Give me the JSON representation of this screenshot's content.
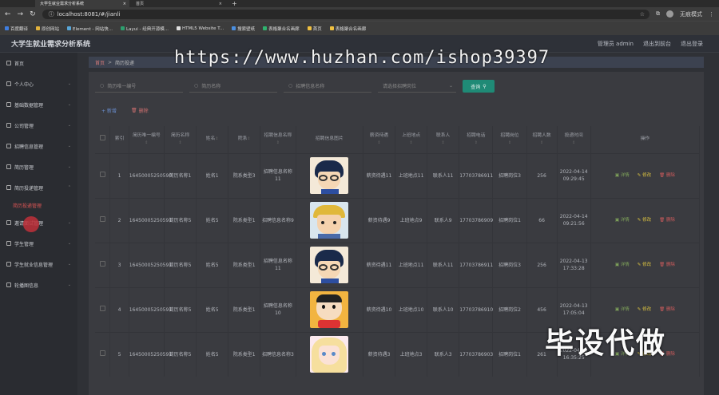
{
  "browser": {
    "tabs": [
      {
        "title": "大学生就业需求分析系统"
      },
      {
        "title": "首页"
      }
    ],
    "url": "localhost:8081/#/jianli",
    "new_tab": "+",
    "profile": "无痕模式",
    "bookmarks": [
      "百度翻译",
      "原创网站",
      "Element - 网站快...",
      "Layui - 经典开源模...",
      "HTML5 Website T...",
      "搜索壁纸",
      "表格聚合名画廊",
      "首页",
      "表格聚合名画廊"
    ]
  },
  "header": {
    "title": "大学生就业需求分析系统",
    "user": "管理员 admin",
    "back": "退出到前台",
    "logout": "退出登录"
  },
  "sidebar": {
    "items": [
      {
        "label": "首页",
        "icon": "home-icon"
      },
      {
        "label": "个人中心",
        "icon": "user-icon"
      },
      {
        "label": "基础数据管理",
        "icon": "database-icon"
      },
      {
        "label": "公司管理",
        "icon": "building-icon"
      },
      {
        "label": "招聘信息管理",
        "icon": "briefcase-icon"
      },
      {
        "label": "简历管理",
        "icon": "document-icon"
      },
      {
        "label": "简历投递管理",
        "icon": "send-icon"
      },
      {
        "label": "邀请面试管理",
        "icon": "calendar-icon"
      },
      {
        "label": "学生管理",
        "icon": "student-icon"
      },
      {
        "label": "学生就业信息管理",
        "icon": "chart-icon"
      },
      {
        "label": "轮播图信息",
        "icon": "image-icon"
      }
    ],
    "sub_item": "简历投递管理"
  },
  "breadcrumb": {
    "home": "首页",
    "sep": ">",
    "current": "简历投递"
  },
  "search": {
    "jianli_no": "简历唯一编号",
    "jianli_name": "简历名称",
    "zhaopin_name": "招聘信息名称",
    "zhaopin_post": "请选择招聘岗位",
    "query": "查询"
  },
  "actions": {
    "add": "+ 新增",
    "del": "删除"
  },
  "table": {
    "headers": [
      "索引",
      "简历唯一编号",
      "简历名称",
      "姓名",
      "院系",
      "招聘信息名称",
      "招聘信息图片",
      "薪资待遇",
      "上班地点",
      "联系人",
      "招聘电话",
      "招聘岗位",
      "招聘人数",
      "投递时间",
      "操作"
    ],
    "rows": [
      {
        "idx": "1",
        "no": "16450005250590",
        "jname": "简历名称1",
        "name": "姓名1",
        "dept": "院系类型3",
        "zname": "招聘信息名称11",
        "salary": "薪资待遇11",
        "place": "上班地点11",
        "contact": "联系人11",
        "phone": "17703786911",
        "post": "招聘岗位3",
        "num": "256",
        "time": "2022-04-14 09:29:45",
        "img": "conan"
      },
      {
        "idx": "2",
        "no": "16450005250591",
        "jname": "简历名称5",
        "name": "姓名5",
        "dept": "院系类型1",
        "zname": "招聘信息名称9",
        "salary": "薪资待遇9",
        "place": "上班地点9",
        "contact": "联系人9",
        "phone": "17703786909",
        "post": "招聘岗位1",
        "num": "66",
        "time": "2022-04-14 09:21:56",
        "img": "boy"
      },
      {
        "idx": "3",
        "no": "16450005250591",
        "jname": "简历名称5",
        "name": "姓名5",
        "dept": "院系类型1",
        "zname": "招聘信息名称11",
        "salary": "薪资待遇11",
        "place": "上班地点11",
        "contact": "联系人11",
        "phone": "17703786911",
        "post": "招聘岗位3",
        "num": "256",
        "time": "2022-04-13 17:33:28",
        "img": "conan"
      },
      {
        "idx": "4",
        "no": "16450005250591",
        "jname": "简历名称5",
        "name": "姓名5",
        "dept": "院系类型1",
        "zname": "招聘信息名称10",
        "salary": "薪资待遇10",
        "place": "上班地点10",
        "contact": "联系人10",
        "phone": "17703786910",
        "post": "招聘岗位2",
        "num": "456",
        "time": "2022-04-13 17:05:04",
        "img": "shin"
      },
      {
        "idx": "5",
        "no": "16450005250591",
        "jname": "简历名称5",
        "name": "姓名5",
        "dept": "院系类型1",
        "zname": "招聘信息名称3",
        "salary": "薪资待遇3",
        "place": "上班地点3",
        "contact": "联系人3",
        "phone": "17703786903",
        "post": "招聘岗位1",
        "num": "261",
        "time": "2022-04-13 16:35:25",
        "img": "girl"
      }
    ],
    "ops": {
      "view": "详情",
      "edit": "修改",
      "del": "删除"
    }
  },
  "overlay": {
    "watermark": "https://www.huzhan.com/ishop39397",
    "stamp": "毕设代做"
  }
}
